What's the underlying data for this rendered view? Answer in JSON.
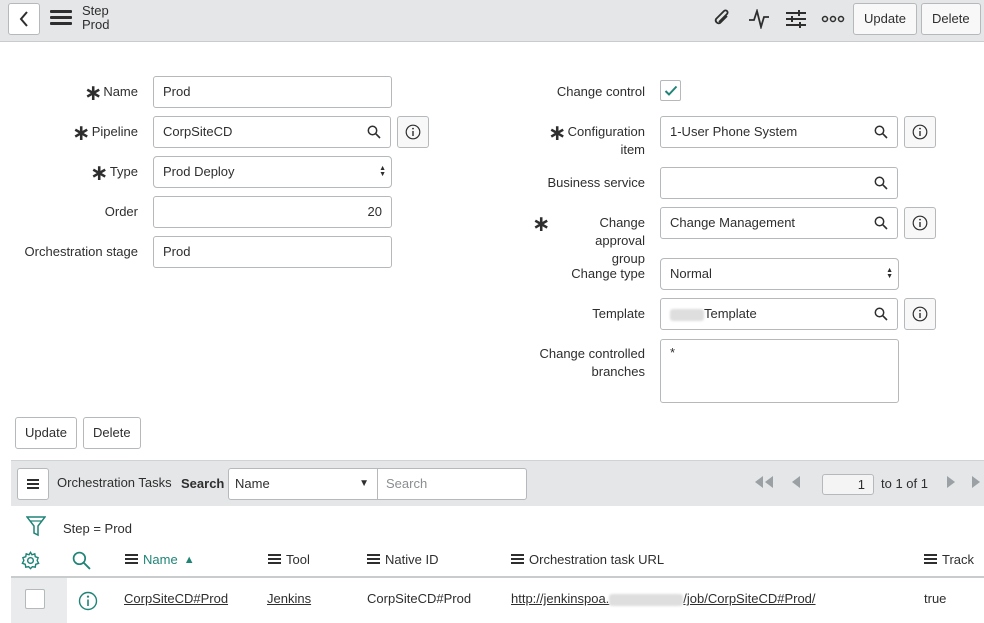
{
  "header": {
    "title_line1": "Step",
    "title_line2": "Prod",
    "update_label": "Update",
    "delete_label": "Delete"
  },
  "form": {
    "name": {
      "label": "Name",
      "value": "Prod"
    },
    "pipeline": {
      "label": "Pipeline",
      "value": "CorpSiteCD"
    },
    "type": {
      "label": "Type",
      "value": "Prod Deploy"
    },
    "order": {
      "label": "Order",
      "value": "20"
    },
    "orchestration_stage": {
      "label": "Orchestration stage",
      "value": "Prod"
    },
    "change_control": {
      "label": "Change control",
      "checked": true
    },
    "configuration_item": {
      "label_line1": "Configuration",
      "label_line2": "item",
      "value": "1-User Phone System"
    },
    "business_service": {
      "label": "Business service",
      "value": ""
    },
    "change_approval_group": {
      "label_line1": "Change approval",
      "label_line2": "group",
      "value": "Change Management"
    },
    "change_type": {
      "label": "Change type",
      "value": "Normal"
    },
    "template": {
      "label": "Template",
      "value": "Template"
    },
    "change_controlled_branches": {
      "label_line1": "Change controlled",
      "label_line2": "branches",
      "value": "*"
    },
    "update_label": "Update",
    "delete_label": "Delete"
  },
  "related_list": {
    "title": "Orchestration Tasks",
    "search_label": "Search",
    "search_field": "Name",
    "search_placeholder": "Search",
    "page_value": "1",
    "page_of": "to 1 of 1",
    "filter_text": "Step = Prod",
    "columns": [
      "Name",
      "Tool",
      "Native ID",
      "Orchestration task URL",
      "Track"
    ],
    "sort_indicator": "▲",
    "rows": [
      {
        "name": "CorpSiteCD#Prod",
        "tool": "Jenkins",
        "native_id": "CorpSiteCD#Prod",
        "url_prefix": "http://jenkinspoa.",
        "url_suffix": "/job/CorpSiteCD#Prod/",
        "track": "true"
      }
    ]
  },
  "colors": {
    "accent": "#1f8476",
    "header_bg": "#e4e6e7",
    "border": "#b5b9bb"
  },
  "icons": [
    "back-icon",
    "menu-icon",
    "attachment-icon",
    "activity-icon",
    "settings-sliders-icon",
    "more-icon",
    "search-icon",
    "info-icon",
    "checkmark-icon",
    "filter-icon",
    "gear-icon",
    "first-page-icon",
    "prev-page-icon",
    "next-page-icon",
    "last-page-icon"
  ]
}
